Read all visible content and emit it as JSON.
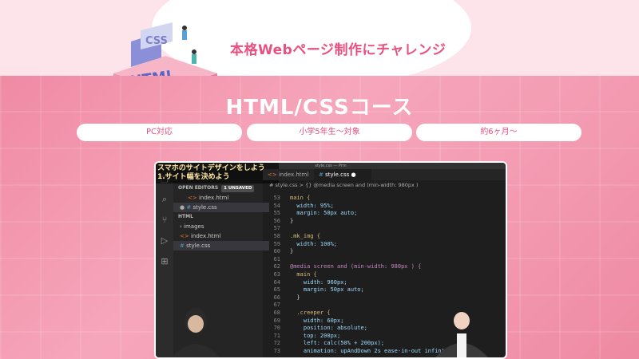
{
  "hero": {
    "tagline": "本格Webページ制作にチャレンジ",
    "course_title": "HTML/CSSコース"
  },
  "art": {
    "css_label": "CSS",
    "html_label": "HTML"
  },
  "pills": [
    "PC対応",
    "小学5年生〜対象",
    "約6ヶ月〜"
  ],
  "editor": {
    "window_title": "style.css — Prm",
    "caption_line1": "スマホのサイトデザインをしよう",
    "caption_line2": "1.サイト幅を決めよう",
    "tabs": [
      "index.html",
      "style.css"
    ],
    "breadcrumb": "#  style.css  >  {} @media screen and (min-width: 980px )",
    "explorer": {
      "open_editors": "OPEN EDITORS",
      "unsaved_badge": "1 UNSAVED",
      "open_files": [
        "index.html",
        "style.css"
      ],
      "folder": "HTML",
      "tree": [
        "images",
        "index.html",
        "style.css"
      ]
    },
    "activity_icons": [
      "files-icon",
      "search-icon",
      "source-control-icon",
      "debug-icon",
      "extensions-icon"
    ],
    "lines": [
      {
        "n": "53",
        "t": "main {"
      },
      {
        "n": "54",
        "t": "  width: 95%;"
      },
      {
        "n": "55",
        "t": "  margin: 50px auto;"
      },
      {
        "n": "56",
        "t": "}"
      },
      {
        "n": "57",
        "t": ""
      },
      {
        "n": "58",
        "t": ".mk_img {"
      },
      {
        "n": "59",
        "t": "  width: 100%;"
      },
      {
        "n": "60",
        "t": "}"
      },
      {
        "n": "61",
        "t": ""
      },
      {
        "n": "62",
        "t": "@media screen and (min-width: 980px ) {"
      },
      {
        "n": "63",
        "t": "  main {"
      },
      {
        "n": "64",
        "t": "    width: 960px;"
      },
      {
        "n": "65",
        "t": "    margin: 50px auto;"
      },
      {
        "n": "66",
        "t": "  }"
      },
      {
        "n": "67",
        "t": ""
      },
      {
        "n": "68",
        "t": "  .creeper {"
      },
      {
        "n": "69",
        "t": "    width: 60px;"
      },
      {
        "n": "70",
        "t": "    position: absolute;"
      },
      {
        "n": "71",
        "t": "    top: 200px;"
      },
      {
        "n": "72",
        "t": "    left: calc(50% + 200px);"
      },
      {
        "n": "73",
        "t": "    animation: upAndDown 2s ease-in-out infini"
      }
    ]
  },
  "colors": {
    "accent": "#e8507f",
    "pink_bg": "#f7a3b8",
    "editor_bg": "#1e1e1e"
  }
}
